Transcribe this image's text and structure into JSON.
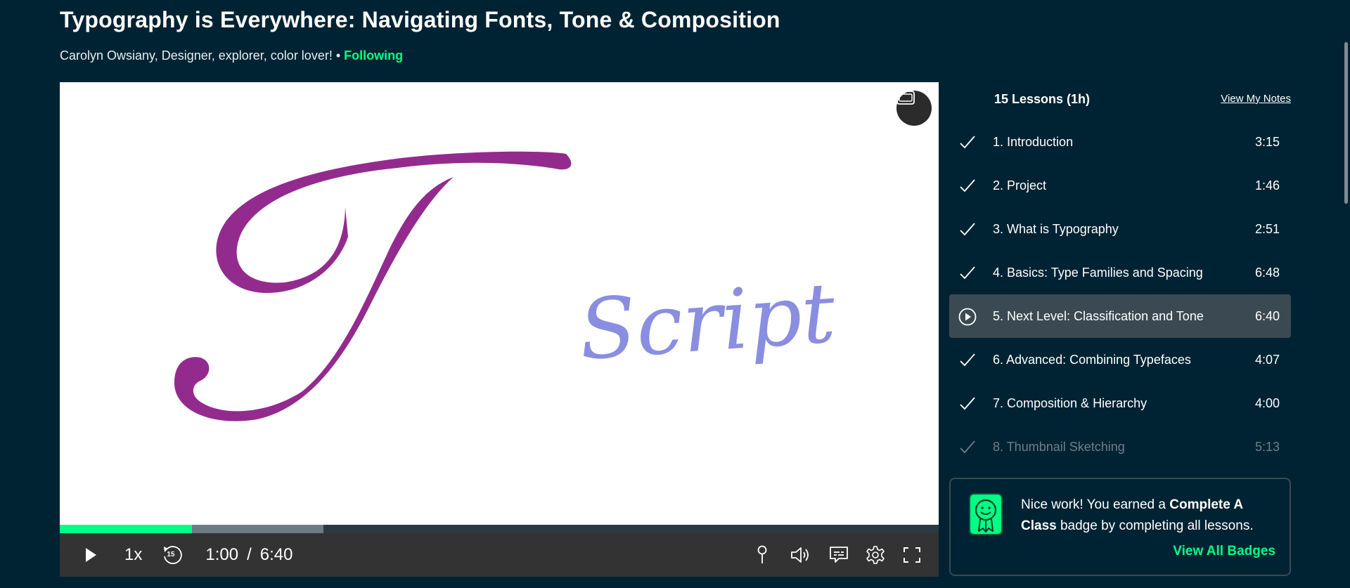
{
  "course": {
    "title": "Typography is Everywhere: Navigating Fonts, Tone & Composition",
    "byline": "Carolyn Owsiany, Designer, explorer, color lover! •",
    "follow_label": "Following"
  },
  "video": {
    "slide_letter": "T",
    "slide_word": "Script",
    "played_fraction": 0.15,
    "buffered_fraction": 0.3
  },
  "controls": {
    "speed": "1x",
    "skip_seconds": "15",
    "current_time": "1:00",
    "separator": "/",
    "duration": "6:40"
  },
  "sidebar": {
    "lessons_count": "15 Lessons (1h)",
    "view_notes": "View My Notes",
    "lessons": [
      {
        "name": "1. Introduction",
        "duration": "3:15",
        "status": "done"
      },
      {
        "name": "2. Project",
        "duration": "1:46",
        "status": "done"
      },
      {
        "name": "3. What is Typography",
        "duration": "2:51",
        "status": "done"
      },
      {
        "name": "4. Basics: Type Families and Spacing",
        "duration": "6:48",
        "status": "done"
      },
      {
        "name": "5. Next Level: Classification and Tone",
        "duration": "6:40",
        "status": "playing"
      },
      {
        "name": "6. Advanced: Combining Typefaces",
        "duration": "4:07",
        "status": "done"
      },
      {
        "name": "7. Composition & Hierarchy",
        "duration": "4:00",
        "status": "done"
      },
      {
        "name": "8. Thumbnail Sketching",
        "duration": "5:13",
        "status": "done"
      }
    ]
  },
  "badge": {
    "text_before": "Nice work! You earned a ",
    "badge_name": "Complete A Class",
    "text_after": " badge by completing all lessons.",
    "link": "View All Badges"
  },
  "colors": {
    "background": "#002333",
    "accent": "#00ff84",
    "controls_bar": "#333333",
    "active_lesson": "#3b4a52",
    "letter_T": "#932b8e",
    "script_word": "#8a8ee0"
  }
}
